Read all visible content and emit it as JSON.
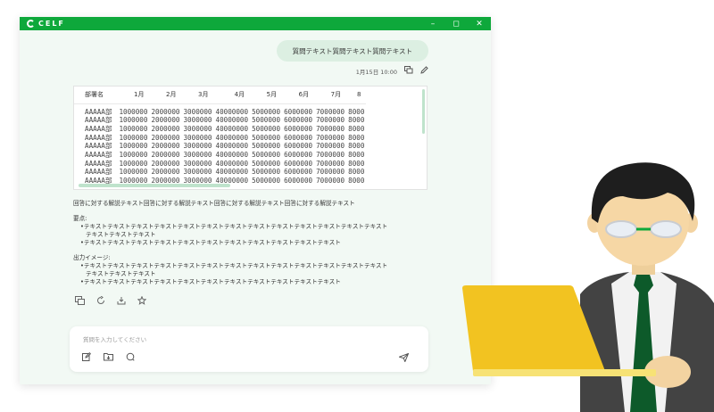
{
  "app": {
    "logo_text": "CELF"
  },
  "window_controls": {
    "minimize": "–",
    "maximize": "◻",
    "close": "✕"
  },
  "chat": {
    "question": "質問テキスト質問テキスト質問テキスト",
    "timestamp": "1月15日 10:00"
  },
  "table": {
    "headers": [
      "部署名",
      "1月",
      "2月",
      "3月",
      "4月",
      "5月",
      "6月",
      "7月",
      "8"
    ],
    "rows": [
      [
        "AAAAA部",
        "1000000",
        "2000000",
        "3000000",
        "40000000",
        "5000000",
        "6000000",
        "7000000",
        "8000"
      ],
      [
        "AAAAA部",
        "1000000",
        "2000000",
        "3000000",
        "40000000",
        "5000000",
        "6000000",
        "7000000",
        "8000"
      ],
      [
        "AAAAA部",
        "1000000",
        "2000000",
        "3000000",
        "40000000",
        "5000000",
        "6000000",
        "7000000",
        "8000"
      ],
      [
        "AAAAA部",
        "1000000",
        "2000000",
        "3000000",
        "40000000",
        "5000000",
        "6000000",
        "7000000",
        "8000"
      ],
      [
        "AAAAA部",
        "1000000",
        "2000000",
        "3000000",
        "40000000",
        "5000000",
        "6000000",
        "7000000",
        "8000"
      ],
      [
        "AAAAA部",
        "1000000",
        "2000000",
        "3000000",
        "40000000",
        "5000000",
        "6000000",
        "7000000",
        "8000"
      ],
      [
        "AAAAA部",
        "1000000",
        "2000000",
        "3000000",
        "40000000",
        "5000000",
        "6000000",
        "7000000",
        "8000"
      ],
      [
        "AAAAA部",
        "1000000",
        "2000000",
        "3000000",
        "40000000",
        "5000000",
        "6000000",
        "7000000",
        "8000"
      ],
      [
        "AAAAA部",
        "1000000",
        "2000000",
        "3000000",
        "40000000",
        "5000000",
        "6000000",
        "7000000",
        "8000"
      ]
    ]
  },
  "answer": {
    "intro": "回答に対する解説テキスト回答に対する解説テキスト回答に対する解説テキスト回答に対する解説テキスト",
    "section1_title": "要点:",
    "section1_item1_line1": "•テキストテキストテキストテキストテキストテキストテキストテキストテキストテキストテキストテキストテキスト",
    "section1_item1_line2": "テキストテキストテキスト",
    "section1_item2": "•テキストテキストテキストテキストテキストテキストテキストテキストテキストテキストテキスト",
    "section2_title": "出力イメージ:",
    "section2_item1_line1": "•テキストテキストテキストテキストテキストテキストテキストテキストテキストテキストテキストテキストテキスト",
    "section2_item1_line2": "テキストテキストテキスト",
    "section2_item2": "•テキストテキストテキストテキストテキストテキストテキストテキストテキストテキストテキスト"
  },
  "input": {
    "placeholder": "質問を入力してください"
  },
  "colors": {
    "brand_green": "#0ea83b",
    "window_bg": "#f2f9f4",
    "bubble_bg": "#dcefe2"
  }
}
